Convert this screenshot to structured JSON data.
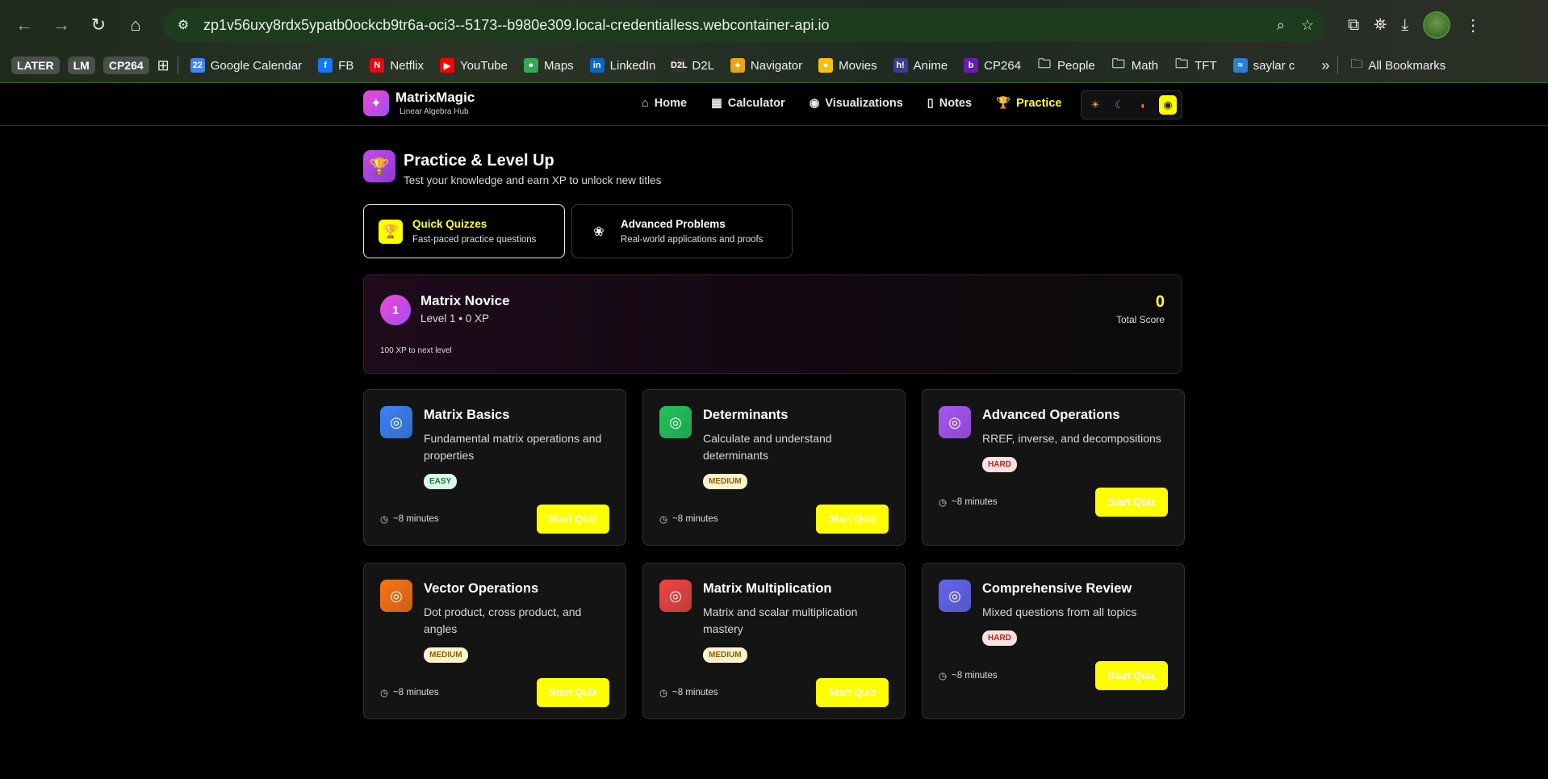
{
  "browser": {
    "url": "zp1v56uxy8rdx5ypatb0ockcb9tr6a-oci3--5173--b980e309.local-credentialless.webcontainer-api.io",
    "bookmark_chips": [
      "LATER",
      "LM",
      "CP264"
    ],
    "bookmarks": [
      {
        "label": "Google Calendar",
        "icon": "22",
        "color": "#4285f4"
      },
      {
        "label": "FB",
        "icon": "f",
        "color": "#1877f2"
      },
      {
        "label": "Netflix",
        "icon": "N",
        "color": "#e50914"
      },
      {
        "label": "YouTube",
        "icon": "▶",
        "color": "#ff0000"
      },
      {
        "label": "Maps",
        "icon": "●",
        "color": "#34a853"
      },
      {
        "label": "LinkedIn",
        "icon": "in",
        "color": "#0a66c2"
      },
      {
        "label": "D2L",
        "icon": "D2L",
        "color": "#333333"
      },
      {
        "label": "Navigator",
        "icon": "✦",
        "color": "#e8a317"
      },
      {
        "label": "Movies",
        "icon": "●",
        "color": "#f4c20d"
      },
      {
        "label": "Anime",
        "icon": "h!",
        "color": "#3d3d8f"
      },
      {
        "label": "CP264",
        "icon": "b",
        "color": "#6a1bb0"
      },
      {
        "label": "People",
        "icon": "folder",
        "color": ""
      },
      {
        "label": "Math",
        "icon": "folder",
        "color": ""
      },
      {
        "label": "TFT",
        "icon": "folder",
        "color": ""
      },
      {
        "label": "saylar c",
        "icon": "≈",
        "color": "#2d7fd1"
      }
    ],
    "more": "»",
    "all_bookmarks": "All Bookmarks"
  },
  "app": {
    "brand": "MatrixMagic",
    "tagline": "Linear Algebra Hub",
    "nav": [
      {
        "label": "Home",
        "icon": "home-icon"
      },
      {
        "label": "Calculator",
        "icon": "calculator-icon"
      },
      {
        "label": "Visualizations",
        "icon": "eye-icon"
      },
      {
        "label": "Notes",
        "icon": "book-icon"
      },
      {
        "label": "Practice",
        "icon": "trophy-icon",
        "active": true
      }
    ],
    "accent": "#ffff00"
  },
  "page": {
    "title": "Practice & Level Up",
    "subtitle": "Test your knowledge and earn XP to unlock new titles",
    "tabs": [
      {
        "title": "Quick Quizzes",
        "subtitle": "Fast-paced practice questions",
        "active": true
      },
      {
        "title": "Advanced Problems",
        "subtitle": "Real-world applications and proofs",
        "active": false
      }
    ]
  },
  "level": {
    "number": "1",
    "title": "Matrix Novice",
    "subtitle": "Level 1 • 0 XP",
    "score": "0",
    "score_label": "Total Score",
    "to_next": "100 XP to next level"
  },
  "quizzes": [
    {
      "title": "Matrix Basics",
      "desc": "Fundamental matrix operations and properties",
      "difficulty": "EASY",
      "level": "easy",
      "time": "~8 minutes",
      "button": "Start Quiz",
      "color": "#3b82f6"
    },
    {
      "title": "Determinants",
      "desc": "Calculate and understand determinants",
      "difficulty": "MEDIUM",
      "level": "medium",
      "time": "~8 minutes",
      "button": "Start Quiz",
      "color": "#22c55e"
    },
    {
      "title": "Advanced Operations",
      "desc": "RREF, inverse, and decompositions",
      "difficulty": "HARD",
      "level": "hard",
      "time": "~8 minutes",
      "button": "Start Quiz",
      "color": "#a855f7"
    },
    {
      "title": "Vector Operations",
      "desc": "Dot product, cross product, and angles",
      "difficulty": "MEDIUM",
      "level": "medium",
      "time": "~8 minutes",
      "button": "Start Quiz",
      "color": "#f97316"
    },
    {
      "title": "Matrix Multiplication",
      "desc": "Matrix and scalar multiplication mastery",
      "difficulty": "MEDIUM",
      "level": "medium",
      "time": "~8 minutes",
      "button": "Start Quiz",
      "color": "#ef4444"
    },
    {
      "title": "Comprehensive Review",
      "desc": "Mixed questions from all topics",
      "difficulty": "HARD",
      "level": "hard",
      "time": "~8 minutes",
      "button": "Start Quiz",
      "color": "#6366f1"
    }
  ]
}
